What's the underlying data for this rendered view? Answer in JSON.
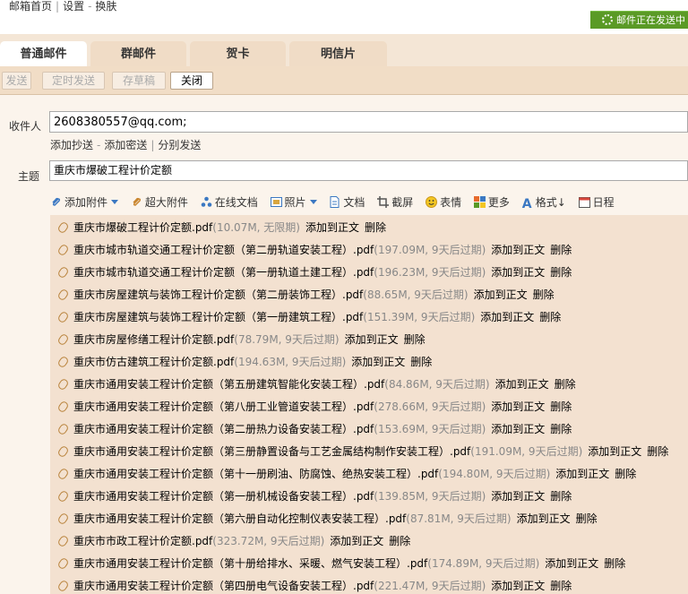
{
  "topnav": {
    "home": "邮箱首页",
    "settings": "设置",
    "skin": "换肤"
  },
  "status": {
    "text": "邮件正在发送中"
  },
  "tabs": [
    "普通邮件",
    "群邮件",
    "贺卡",
    "明信片"
  ],
  "toolbar": {
    "send": "发送",
    "scheduled": "定时发送",
    "draft": "存草稿",
    "close": "关闭"
  },
  "compose": {
    "to_label": "收件人",
    "to_value": "2608380557@qq.com;",
    "links": {
      "cc": "添加抄送",
      "bcc": "添加密送",
      "separate": "分别发送"
    },
    "subject_label": "主题",
    "subject_value": "重庆市爆破工程计价定额"
  },
  "tools": [
    "添加附件",
    "超大附件",
    "在线文档",
    "照片",
    "文档",
    "截屏",
    "表情",
    "更多",
    "格式↓",
    "日程"
  ],
  "attachments": [
    {
      "name": "重庆市爆破工程计价定额.pdf",
      "info": "(10.07M, 无限期)"
    },
    {
      "name": "重庆市城市轨道交通工程计价定额（第二册轨道安装工程）.pdf",
      "info": "(197.09M, 9天后过期)"
    },
    {
      "name": "重庆市城市轨道交通工程计价定额（第一册轨道土建工程）.pdf",
      "info": "(196.23M, 9天后过期)"
    },
    {
      "name": "重庆市房屋建筑与装饰工程计价定额（第二册装饰工程）.pdf",
      "info": "(88.65M, 9天后过期)"
    },
    {
      "name": "重庆市房屋建筑与装饰工程计价定额（第一册建筑工程）.pdf",
      "info": "(151.39M, 9天后过期)"
    },
    {
      "name": "重庆市房屋修缮工程计价定额.pdf",
      "info": "(78.79M, 9天后过期)"
    },
    {
      "name": "重庆市仿古建筑工程计价定额.pdf",
      "info": "(194.63M, 9天后过期)"
    },
    {
      "name": "重庆市通用安装工程计价定额（第五册建筑智能化安装工程）.pdf",
      "info": "(84.86M, 9天后过期)"
    },
    {
      "name": "重庆市通用安装工程计价定额（第八册工业管道安装工程）.pdf",
      "info": "(278.66M, 9天后过期)"
    },
    {
      "name": "重庆市通用安装工程计价定额（第二册热力设备安装工程）.pdf",
      "info": "(153.69M, 9天后过期)"
    },
    {
      "name": "重庆市通用安装工程计价定额（第三册静置设备与工艺金属结构制作安装工程）.pdf",
      "info": "(191.09M, 9天后过期)"
    },
    {
      "name": "重庆市通用安装工程计价定额（第十一册刷油、防腐蚀、绝热安装工程）.pdf",
      "info": "(194.80M, 9天后过期)"
    },
    {
      "name": "重庆市通用安装工程计价定额（第一册机械设备安装工程）.pdf",
      "info": "(139.85M, 9天后过期)"
    },
    {
      "name": "重庆市通用安装工程计价定额（第六册自动化控制仪表安装工程）.pdf",
      "info": "(87.81M, 9天后过期)"
    },
    {
      "name": "重庆市市政工程计价定额.pdf",
      "info": "(323.72M, 9天后过期)"
    },
    {
      "name": "重庆市通用安装工程计价定额（第十册给排水、采暖、燃气安装工程）.pdf",
      "info": "(174.89M, 9天后过期)"
    },
    {
      "name": "重庆市通用安装工程计价定额（第四册电气设备安装工程）.pdf",
      "info": "(221.47M, 9天后过期)"
    }
  ],
  "attachment_actions": {
    "add_to_body": "添加到正文",
    "delete": "删除"
  },
  "colors": {
    "status_green": "#5a9a26",
    "toolbar_bg": "#f1ddc6",
    "attach_bg": "#f3e1d0",
    "clip": "#b8823a"
  }
}
